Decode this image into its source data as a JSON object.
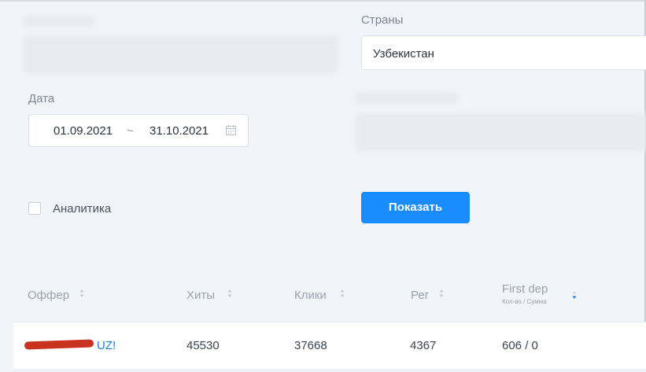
{
  "filters": {
    "countries_label": "Страны",
    "countries_value": "Узбекистан",
    "date_label": "Дата",
    "date_from": "01.09.2021",
    "date_separator": "~",
    "date_to": "31.10.2021",
    "analytics_label": "Аналитика",
    "analytics_checked": false,
    "show_button": "Показать"
  },
  "table": {
    "headers": {
      "offer": "Оффер",
      "hits": "Хиты",
      "clicks": "Клики",
      "reg": "Рег",
      "first_dep": "First dep",
      "first_dep_sub": "Кол-во / Сумма"
    },
    "rows": [
      {
        "offer_suffix": "UZ!",
        "hits": "45530",
        "clicks": "37668",
        "reg": "4367",
        "first_dep": "606 / 0"
      }
    ]
  },
  "colors": {
    "accent": "#1a8cff",
    "background": "#f1f4f8",
    "redaction": "#c8321f"
  },
  "icons": [
    "calendar-icon",
    "sort-icon",
    "sort-desc-icon"
  ]
}
